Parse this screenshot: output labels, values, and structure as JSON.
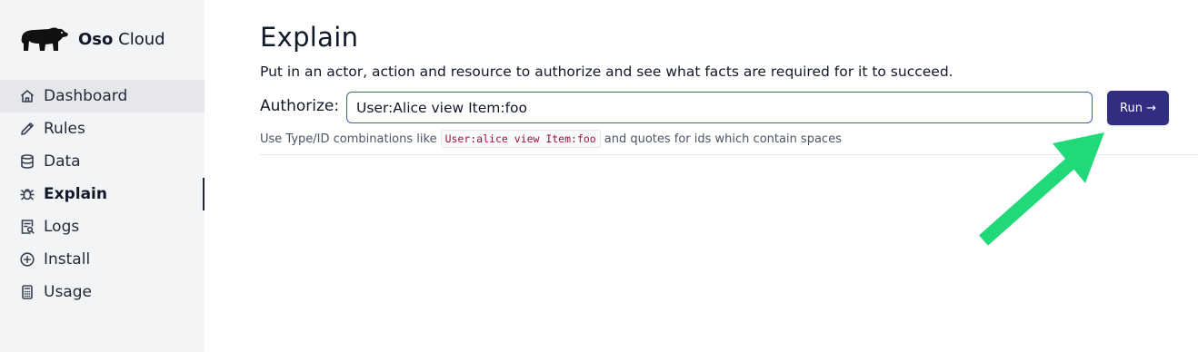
{
  "brand": {
    "name_bold": "Oso",
    "name_light": "Cloud",
    "logo_icon": "bear-logo-icon"
  },
  "sidebar": {
    "items": [
      {
        "label": "Dashboard",
        "icon": "home-icon"
      },
      {
        "label": "Rules",
        "icon": "pencil-icon"
      },
      {
        "label": "Data",
        "icon": "database-icon"
      },
      {
        "label": "Explain",
        "icon": "bug-icon"
      },
      {
        "label": "Logs",
        "icon": "log-search-icon"
      },
      {
        "label": "Install",
        "icon": "plus-circle-icon"
      },
      {
        "label": "Usage",
        "icon": "calculator-icon"
      }
    ],
    "active": "Explain",
    "hovered": "Dashboard"
  },
  "main": {
    "title": "Explain",
    "subtitle": "Put in an actor, action and resource to authorize and see what facts are required for it to succeed.",
    "authorize_label": "Authorize:",
    "authorize_value": "User:Alice view Item:foo",
    "run_label": "Run →",
    "hint_prefix": "Use Type/ID combinations like",
    "hint_code": "User:alice view Item:foo",
    "hint_suffix": "and quotes for ids which contain spaces"
  },
  "colors": {
    "sidebar_bg": "#f3f4f6",
    "accent": "#312e81",
    "input_border": "#3b5bdb",
    "annotation_arrow": "#22d97a"
  }
}
